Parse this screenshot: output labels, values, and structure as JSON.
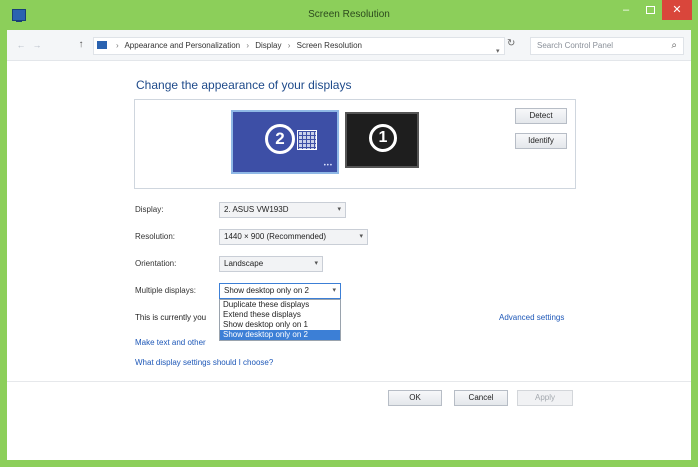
{
  "window": {
    "title": "Screen Resolution",
    "minimize_glyph": "–",
    "close_glyph": "✕"
  },
  "address_bar": {
    "back_glyph": "←",
    "forward_glyph": "→",
    "up_glyph": "↑",
    "crumbs": [
      "Appearance and Personalization",
      "Display",
      "Screen Resolution"
    ],
    "crumb_separator": "›",
    "refresh_glyph": "↻",
    "dropdown_glyph": "▾",
    "search_placeholder": "Search Control Panel"
  },
  "main": {
    "heading": "Change the appearance of your displays",
    "monitors": [
      {
        "label": "2",
        "selected": true
      },
      {
        "label": "1",
        "selected": false
      }
    ],
    "detect_label": "Detect",
    "identify_label": "Identify",
    "form": {
      "display_label": "Display:",
      "display_value": "2. ASUS VW193D",
      "resolution_label": "Resolution:",
      "resolution_value": "1440 × 900 (Recommended)",
      "orientation_label": "Orientation:",
      "orientation_value": "Landscape",
      "multiple_label": "Multiple displays:",
      "multiple_value": "Show desktop only on 2"
    },
    "dropdown_options": [
      "Duplicate these displays",
      "Extend these displays",
      "Show desktop only on 1",
      "Show desktop only on 2"
    ],
    "selected_option_index": 3,
    "currently_text": "This is currently you",
    "advanced_link": "Advanced settings",
    "make_text_link": "Make text and other",
    "what_link": "What display settings should I choose?"
  },
  "footer": {
    "ok_label": "OK",
    "cancel_label": "Cancel",
    "apply_label": "Apply"
  },
  "colors": {
    "titlebar": "#8ccf5a",
    "close_button": "#d9463b",
    "selected_monitor": "#3d4fa6",
    "link": "#1e58b8",
    "selection": "#3c7fd6"
  }
}
